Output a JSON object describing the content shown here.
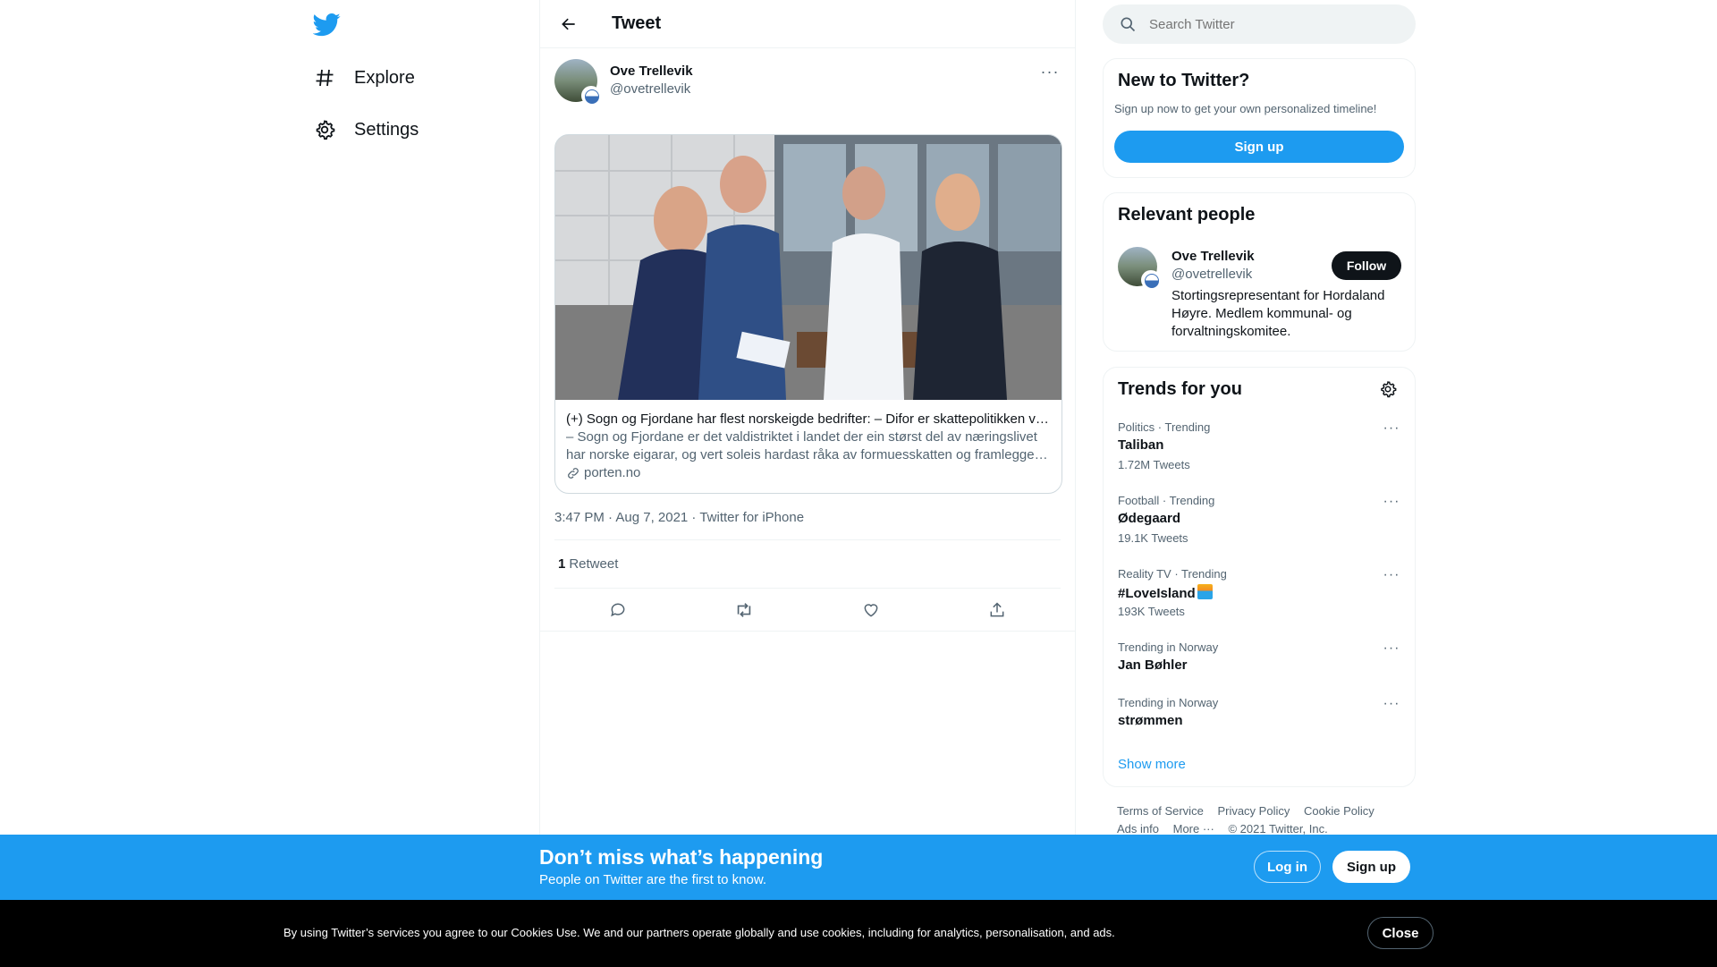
{
  "nav": {
    "items": [
      {
        "label": "Explore",
        "icon": "hashtag-icon"
      },
      {
        "label": "Settings",
        "icon": "gear-icon"
      }
    ]
  },
  "main": {
    "title": "Tweet",
    "tweet": {
      "author_name": "Ove Trellevik",
      "author_handle": "@ovetrellevik",
      "card": {
        "title": "(+) Sogn og Fjordane har flest norskeigde bedrifter: – Difor er skattepolitikken viktig",
        "desc_line1": "– Sogn og Fjordane er det valdistriktet i landet der ein størst del av næringslivet",
        "desc_line2": "har norske eigarar, og vert soleis hardast råka av formuesskatten og framlegget om",
        "domain": "porten.no"
      },
      "timestamp": "3:47 PM · Aug 7, 2021 · Twitter for iPhone",
      "retweet_count": "1",
      "retweet_label": "Retweet"
    }
  },
  "search": {
    "placeholder": "Search Twitter"
  },
  "new_to_twitter": {
    "title": "New to Twitter?",
    "subtitle": "Sign up now to get your own personalized timeline!",
    "signup_label": "Sign up"
  },
  "relevant_people": {
    "title": "Relevant people",
    "name": "Ove Trellevik",
    "handle": "@ovetrellevik",
    "follow_label": "Follow",
    "bio": "Stortingsrepresentant for Hordaland Høyre. Medlem kommunal- og forvaltningskomitee."
  },
  "trends": {
    "title": "Trends for you",
    "items": [
      {
        "context": "Politics · Trending",
        "name": "Taliban",
        "count": "1.72M Tweets"
      },
      {
        "context": "Football · Trending",
        "name": "Ødegaard",
        "count": "19.1K Tweets"
      },
      {
        "context": "Reality TV · Trending",
        "name": "#LoveIsland",
        "count": "193K Tweets"
      },
      {
        "context": "Trending in Norway",
        "name": "Jan Bøhler",
        "count": ""
      },
      {
        "context": "Trending in Norway",
        "name": "strømmen",
        "count": ""
      }
    ],
    "show_more": "Show more"
  },
  "footer": {
    "links": [
      "Terms of Service",
      "Privacy Policy",
      "Cookie Policy",
      "Ads info",
      "More ···"
    ],
    "copyright": "© 2021 Twitter, Inc."
  },
  "bottom_bar": {
    "title": "Don’t miss what’s happening",
    "subtitle": "People on Twitter are the first to know.",
    "login_label": "Log in",
    "signup_label": "Sign up"
  },
  "cookie_bar": {
    "text": "By using Twitter’s services you agree to our Cookies Use. We and our partners operate globally and use cookies, including for analytics, personalisation, and ads.",
    "close_label": "Close"
  },
  "colors": {
    "accent": "#1d9bf0",
    "text": "#0f1419",
    "secondary": "#536471",
    "border": "#eff3f4"
  }
}
